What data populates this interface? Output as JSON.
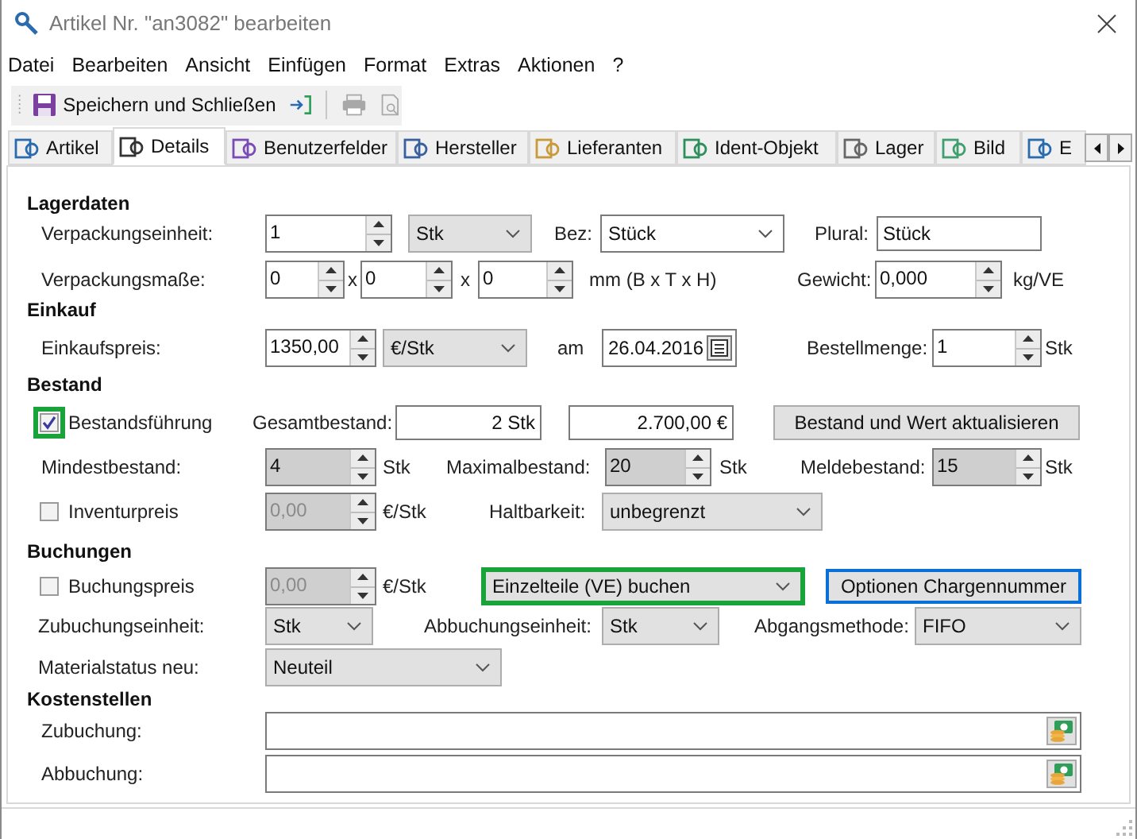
{
  "window": {
    "title": "Artikel Nr. \"an3082\" bearbeiten"
  },
  "menu": [
    {
      "label": "Datei"
    },
    {
      "label": "Bearbeiten"
    },
    {
      "label": "Ansicht"
    },
    {
      "label": "Einfügen"
    },
    {
      "label": "Format"
    },
    {
      "label": "Extras"
    },
    {
      "label": "Aktionen"
    },
    {
      "label": "?"
    }
  ],
  "toolbar": [
    {
      "kind": "save",
      "label": "Speichern und Schließen",
      "disabled": false
    },
    {
      "kind": "exit",
      "disabled": false
    },
    {
      "kind": "separator"
    },
    {
      "kind": "print",
      "disabled": true
    },
    {
      "kind": "preview",
      "disabled": true
    }
  ],
  "tabs": [
    {
      "label": "Artikel",
      "selected": false
    },
    {
      "label": "Details",
      "selected": true
    },
    {
      "label": "Benutzerfelder",
      "selected": false
    },
    {
      "label": "Hersteller",
      "selected": false
    },
    {
      "label": "Lieferanten",
      "selected": false
    },
    {
      "label": "Ident-Objekt",
      "selected": false
    },
    {
      "label": "Lager",
      "selected": false
    },
    {
      "label": "Bild",
      "selected": false
    },
    {
      "label": "E",
      "selected": false
    }
  ],
  "sections": [
    {
      "title": "Lagerdaten",
      "rows": [
        {
          "items": [
            {
              "kind": "label",
              "text": "Verpackungseinheit:"
            },
            {
              "kind": "spin",
              "value": "1",
              "readonly": false,
              "disabled": false
            },
            {
              "kind": "combo",
              "value": "Stk",
              "editable": false
            },
            {
              "kind": "label",
              "text": "Bez:"
            },
            {
              "kind": "combo",
              "value": "Stück",
              "editable": true
            },
            {
              "kind": "label",
              "text": "Plural:"
            },
            {
              "kind": "text",
              "value": "Stück"
            }
          ]
        },
        {
          "items": [
            {
              "kind": "label",
              "text": "Verpackungsmaße:"
            },
            {
              "kind": "spin",
              "value": "0",
              "readonly": false,
              "disabled": false
            },
            {
              "kind": "label",
              "text": "x"
            },
            {
              "kind": "spin",
              "value": "0",
              "readonly": false,
              "disabled": false
            },
            {
              "kind": "label",
              "text": "x"
            },
            {
              "kind": "spin",
              "value": "0",
              "readonly": false,
              "disabled": false
            },
            {
              "kind": "label",
              "text": "mm (B x T x H)"
            },
            {
              "kind": "label",
              "text": "Gewicht:"
            },
            {
              "kind": "spin",
              "value": "0,000",
              "readonly": false,
              "disabled": false
            },
            {
              "kind": "label",
              "text": "kg/VE"
            }
          ]
        }
      ]
    },
    {
      "title": "Einkauf",
      "rows": [
        {
          "items": [
            {
              "kind": "label",
              "text": "Einkaufspreis:"
            },
            {
              "kind": "spin",
              "value": "1350,00",
              "readonly": false,
              "disabled": false
            },
            {
              "kind": "combo",
              "value": "€/Stk",
              "editable": false
            },
            {
              "kind": "label",
              "text": "am"
            },
            {
              "kind": "date",
              "value": "26.04.2016"
            },
            {
              "kind": "label",
              "text": "Bestellmenge:"
            },
            {
              "kind": "spin",
              "value": "1",
              "readonly": false,
              "disabled": false
            },
            {
              "kind": "label",
              "text": "Stk"
            }
          ]
        }
      ]
    },
    {
      "title": "Bestand",
      "rows": [
        {
          "items": [
            {
              "kind": "checkbox",
              "label": "Bestandsführung",
              "checked": true,
              "color": "#1aa33b"
            },
            {
              "kind": "label",
              "text": "Gesamtbestand:"
            },
            {
              "kind": "text",
              "value": "2 Stk"
            },
            {
              "kind": "text",
              "value": "2.700,00 €"
            },
            {
              "kind": "button",
              "label": "Bestand und Wert aktualisieren"
            }
          ]
        },
        {
          "items": [
            {
              "kind": "label",
              "text": "Mindestbestand:"
            },
            {
              "kind": "spin",
              "value": "4",
              "readonly": true,
              "disabled": false
            },
            {
              "kind": "label",
              "text": "Stk"
            },
            {
              "kind": "label",
              "text": "Maximalbestand:"
            },
            {
              "kind": "spin",
              "value": "20",
              "readonly": true,
              "disabled": false
            },
            {
              "kind": "label",
              "text": "Stk"
            },
            {
              "kind": "label",
              "text": "Meldebestand:"
            },
            {
              "kind": "spin",
              "value": "15",
              "readonly": true,
              "disabled": false
            },
            {
              "kind": "label",
              "text": "Stk"
            }
          ]
        },
        {
          "items": [
            {
              "kind": "checkbox",
              "label": "Inventurpreis",
              "checked": false
            },
            {
              "kind": "spin",
              "value": "0,00",
              "readonly": true,
              "disabled": true
            },
            {
              "kind": "label",
              "text": "€/Stk"
            },
            {
              "kind": "label",
              "text": "Haltbarkeit:"
            },
            {
              "kind": "combo",
              "value": "unbegrenzt",
              "editable": false
            }
          ]
        }
      ]
    },
    {
      "title": "Buchungen",
      "rows": [
        {
          "items": [
            {
              "kind": "checkbox",
              "label": "Buchungspreis",
              "checked": false
            },
            {
              "kind": "spin",
              "value": "0,00",
              "readonly": true,
              "disabled": true
            },
            {
              "kind": "label",
              "text": "€/Stk"
            },
            {
              "kind": "combo",
              "value": "Einzelteile (VE) buchen",
              "editable": false,
              "color": "#1aa33b"
            },
            {
              "kind": "button",
              "label": "Optionen Chargennummer",
              "color": "#0a6fd6"
            }
          ]
        },
        {
          "items": [
            {
              "kind": "label",
              "text": "Zubuchungseinheit:"
            },
            {
              "kind": "combo",
              "value": "Stk",
              "editable": false
            },
            {
              "kind": "label",
              "text": "Abbuchungseinheit:"
            },
            {
              "kind": "combo",
              "value": "Stk",
              "editable": false
            },
            {
              "kind": "label",
              "text": "Abgangsmethode:"
            },
            {
              "kind": "combo",
              "value": "FIFO",
              "editable": false
            }
          ]
        },
        {
          "items": [
            {
              "kind": "label",
              "text": "Materialstatus neu:"
            },
            {
              "kind": "combo",
              "value": "Neuteil",
              "editable": false
            }
          ]
        }
      ]
    },
    {
      "title": "Kostenstellen",
      "rows": [
        {
          "items": [
            {
              "kind": "label",
              "text": "Zubuchung:"
            },
            {
              "kind": "lookup"
            }
          ]
        },
        {
          "items": [
            {
              "kind": "label",
              "text": "Abbuchung:"
            },
            {
              "kind": "lookup"
            }
          ]
        }
      ]
    }
  ]
}
